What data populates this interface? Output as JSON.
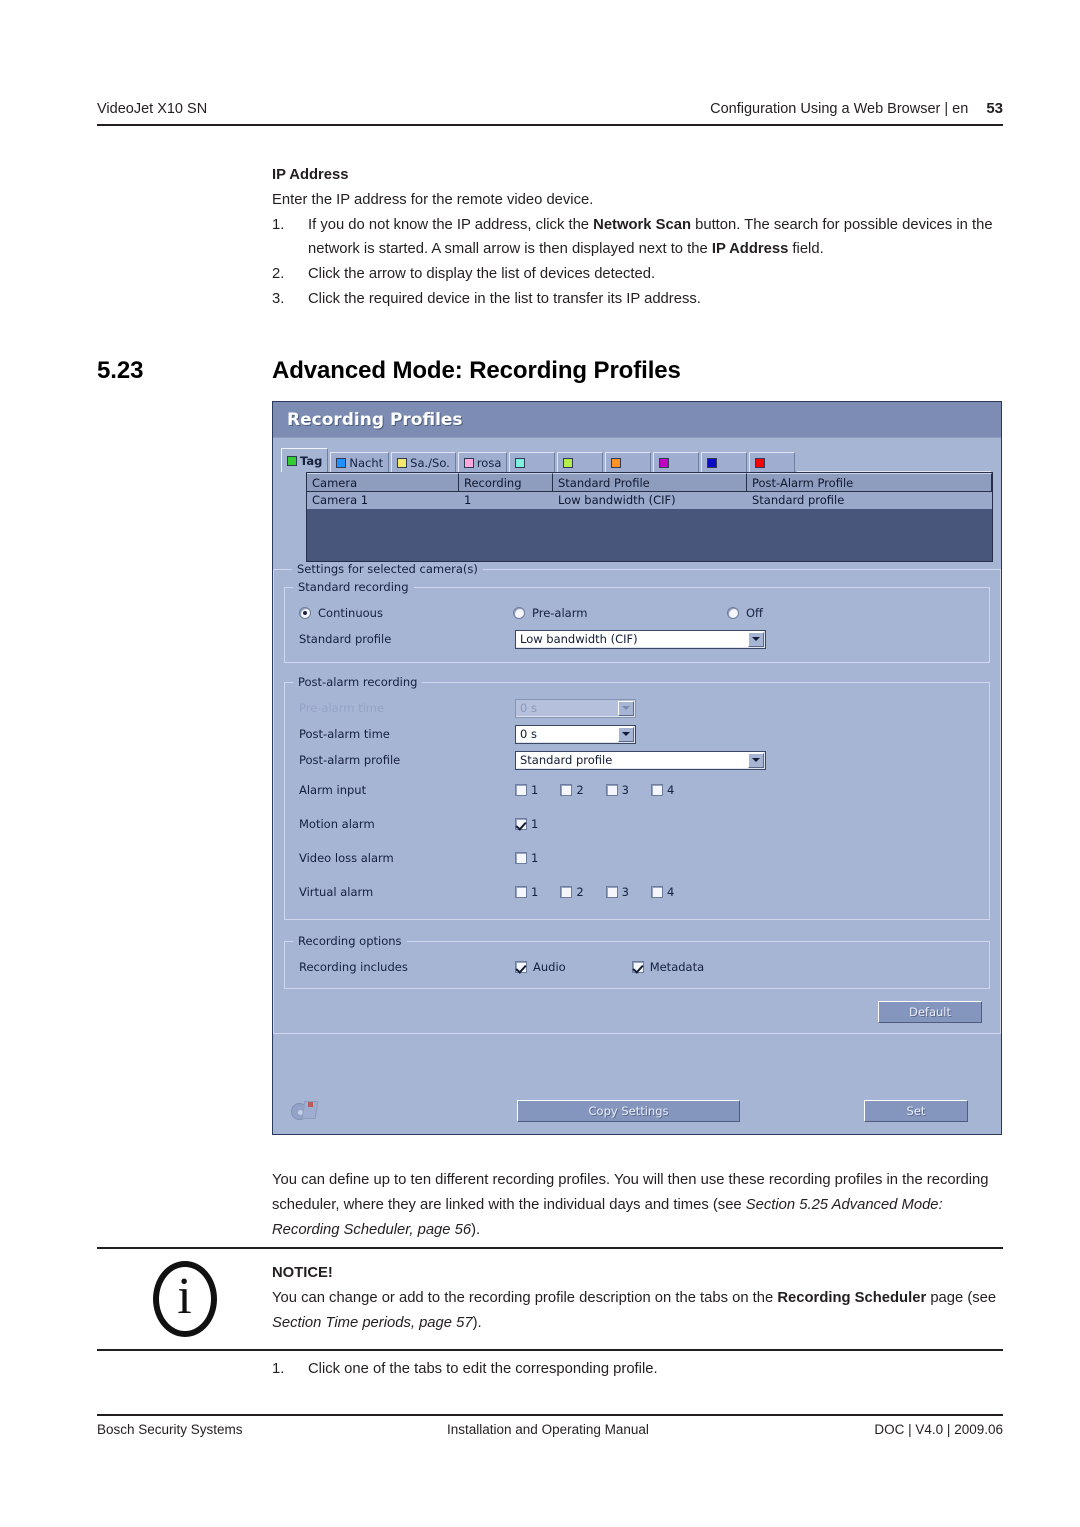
{
  "header": {
    "left": "VideoJet X10 SN",
    "right": "Configuration Using a Web Browser | en",
    "page_number": "53"
  },
  "intro": {
    "title": "IP Address",
    "lead": "Enter the IP address for the remote video device.",
    "steps": [
      {
        "num": "1.",
        "parts": [
          {
            "t": "If you do not know the IP address, click the "
          },
          {
            "t": "Network Scan",
            "b": true
          },
          {
            "t": " button. The search for possible devices in the network is started. A small arrow is then displayed next to the "
          },
          {
            "t": "IP Address",
            "b": true
          },
          {
            "t": " field."
          }
        ]
      },
      {
        "num": "2.",
        "parts": [
          {
            "t": "Click the arrow to display the list of devices detected."
          }
        ]
      },
      {
        "num": "3.",
        "parts": [
          {
            "t": "Click the required device in the list to transfer its IP address."
          }
        ]
      }
    ]
  },
  "section": {
    "number": "5.23",
    "title": "Advanced Mode: Recording Profiles"
  },
  "screenshot": {
    "window_title": "Recording Profiles",
    "tabs": [
      {
        "label": "Tag",
        "color": "#33cc33",
        "active": true
      },
      {
        "label": "Nacht",
        "color": "#1e90ff",
        "active": false
      },
      {
        "label": "Sa./So.",
        "color": "#f2e86b",
        "active": false
      },
      {
        "label": "rosa",
        "color": "#ffa8dd",
        "active": false
      },
      {
        "label": "",
        "color": "#7ff0df",
        "active": false
      },
      {
        "label": "",
        "color": "#b4ef4f",
        "active": false
      },
      {
        "label": "",
        "color": "#ff9326",
        "active": false
      },
      {
        "label": "",
        "color": "#c000c0",
        "active": false
      },
      {
        "label": "",
        "color": "#0c0cc8",
        "active": false
      },
      {
        "label": "",
        "color": "#ff0000",
        "active": false
      }
    ],
    "table": {
      "columns": [
        "Camera",
        "Recording",
        "Standard Profile",
        "Post-Alarm Profile"
      ],
      "rows": [
        [
          "Camera 1",
          "1",
          "Low bandwidth (CIF)",
          "Standard profile"
        ]
      ]
    },
    "settings_group": {
      "legend": "Settings for selected camera(s)",
      "standard_recording": {
        "legend": "Standard recording",
        "radios": [
          {
            "label": "Continuous",
            "checked": true
          },
          {
            "label": "Pre-alarm",
            "checked": false
          },
          {
            "label": "Off",
            "checked": false
          }
        ],
        "standard_profile_label": "Standard profile",
        "standard_profile_value": "Low bandwidth (CIF)"
      },
      "post_alarm_recording": {
        "legend": "Post-alarm recording",
        "pre_alarm_time_label": "Pre-alarm time",
        "pre_alarm_time_value": "0 s",
        "pre_alarm_time_disabled": true,
        "post_alarm_time_label": "Post-alarm time",
        "post_alarm_time_value": "0 s",
        "post_alarm_profile_label": "Post-alarm profile",
        "post_alarm_profile_value": "Standard profile",
        "alarm_input_label": "Alarm input",
        "alarm_input": [
          {
            "label": "1",
            "checked": false
          },
          {
            "label": "2",
            "checked": false
          },
          {
            "label": "3",
            "checked": false
          },
          {
            "label": "4",
            "checked": false
          }
        ],
        "motion_alarm_label": "Motion alarm",
        "motion_alarm": [
          {
            "label": "1",
            "checked": true
          }
        ],
        "video_loss_alarm_label": "Video loss alarm",
        "video_loss_alarm": [
          {
            "label": "1",
            "checked": false
          }
        ],
        "virtual_alarm_label": "Virtual alarm",
        "virtual_alarm": [
          {
            "label": "1",
            "checked": false
          },
          {
            "label": "2",
            "checked": false
          },
          {
            "label": "3",
            "checked": false
          },
          {
            "label": "4",
            "checked": false
          }
        ]
      },
      "recording_options": {
        "legend": "Recording options",
        "includes_label": "Recording includes",
        "items": [
          {
            "label": "Audio",
            "checked": true
          },
          {
            "label": "Metadata",
            "checked": true
          }
        ]
      },
      "default_button": "Default"
    },
    "buttons": {
      "copy_settings": "Copy Settings",
      "set": "Set"
    }
  },
  "description": {
    "parts": [
      {
        "t": "You can define up to ten different recording profiles. You will then use these recording profiles in the recording scheduler, where they are linked with the individual days and times (see "
      },
      {
        "t": "Section 5.25 Advanced Mode: Recording Scheduler, page 56",
        "i": true
      },
      {
        "t": ")."
      }
    ]
  },
  "notice": {
    "icon": "info-icon",
    "icon_glyph": "i",
    "title": "NOTICE!",
    "parts": [
      {
        "t": "You can change or add to the recording profile description on the tabs on the "
      },
      {
        "t": "Recording Scheduler",
        "b": true
      },
      {
        "t": " page (see "
      },
      {
        "t": "Section  Time periods, page 57",
        "i": true
      },
      {
        "t": ")."
      }
    ]
  },
  "final_steps": [
    {
      "num": "1.",
      "parts": [
        {
          "t": "Click one of the tabs to edit the corresponding profile."
        }
      ]
    }
  ],
  "footer": {
    "left": "Bosch Security Systems",
    "middle": "Installation and Operating Manual",
    "right": "DOC | V4.0 | 2009.06"
  }
}
